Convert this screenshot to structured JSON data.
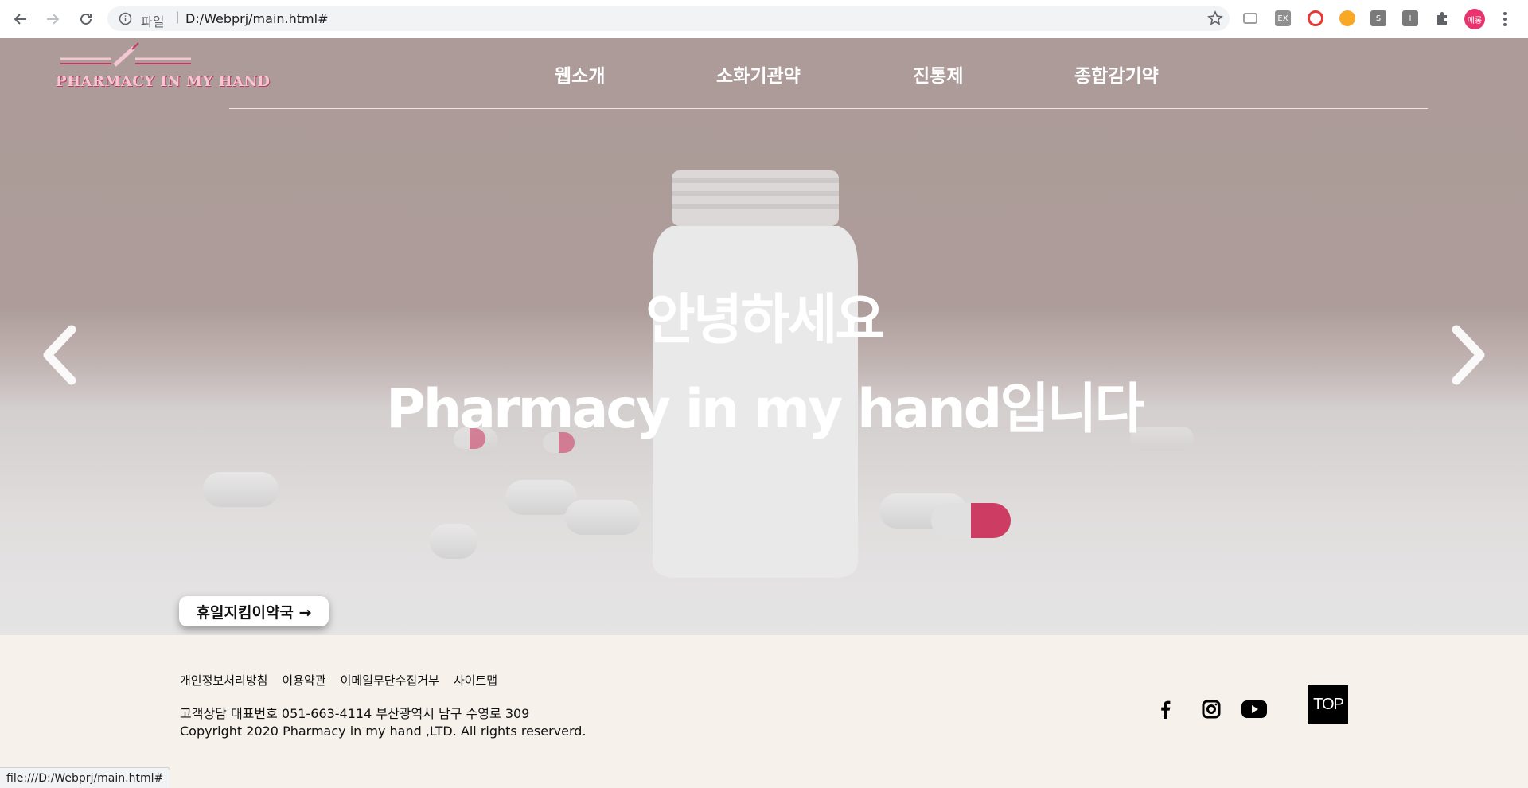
{
  "browser": {
    "scheme_label": "파일",
    "separator": "|",
    "url": "D:/Webprj/main.html#",
    "profile_initials": "메롱",
    "status_url": "file:///D:/Webprj/main.html#",
    "extensions": [
      {
        "icon": "cast-icon",
        "color": "#9e9e9e",
        "text": ""
      },
      {
        "icon": "ex-extension-icon",
        "color": "#8f8f8f",
        "text": "EX"
      },
      {
        "icon": "chrome-color-icon",
        "color": "#e53935",
        "text": ""
      },
      {
        "icon": "bee-icon",
        "color": "#f9a825",
        "text": ""
      },
      {
        "icon": "s-extension-icon",
        "color": "#7a7a7a",
        "text": "S"
      },
      {
        "icon": "i-extension-icon",
        "color": "#7a7a7a",
        "text": "I"
      },
      {
        "icon": "puzzle-icon",
        "color": "#5f6368",
        "text": ""
      }
    ]
  },
  "site": {
    "logo_text": "PHARMACY IN MY HAND",
    "nav": [
      "웹소개",
      "소화기관약",
      "진통제",
      "종합감기약"
    ],
    "hero": {
      "line1": "안녕하세요",
      "line2": "Pharmacy in my hand입니다"
    },
    "holiday_button": "휴일지킴이약국 →"
  },
  "footer": {
    "links": [
      "개인정보처리방침",
      "이용약관",
      "이메일무단수집거부",
      "사이트맵"
    ],
    "contact": "고객상담 대표번호 051-663-4114 부산광역시 남구 수영로 309",
    "copyright": "Copyright 2020 Pharmacy in my hand ,LTD. All rights reserverd.",
    "social": [
      "facebook-icon",
      "instagram-icon",
      "youtube-icon"
    ],
    "top_label": "TOP"
  },
  "colors": {
    "accent_pink": "#e8336d",
    "footer_bg": "#f6f1ea",
    "hero_tint": "#b2a19e"
  }
}
